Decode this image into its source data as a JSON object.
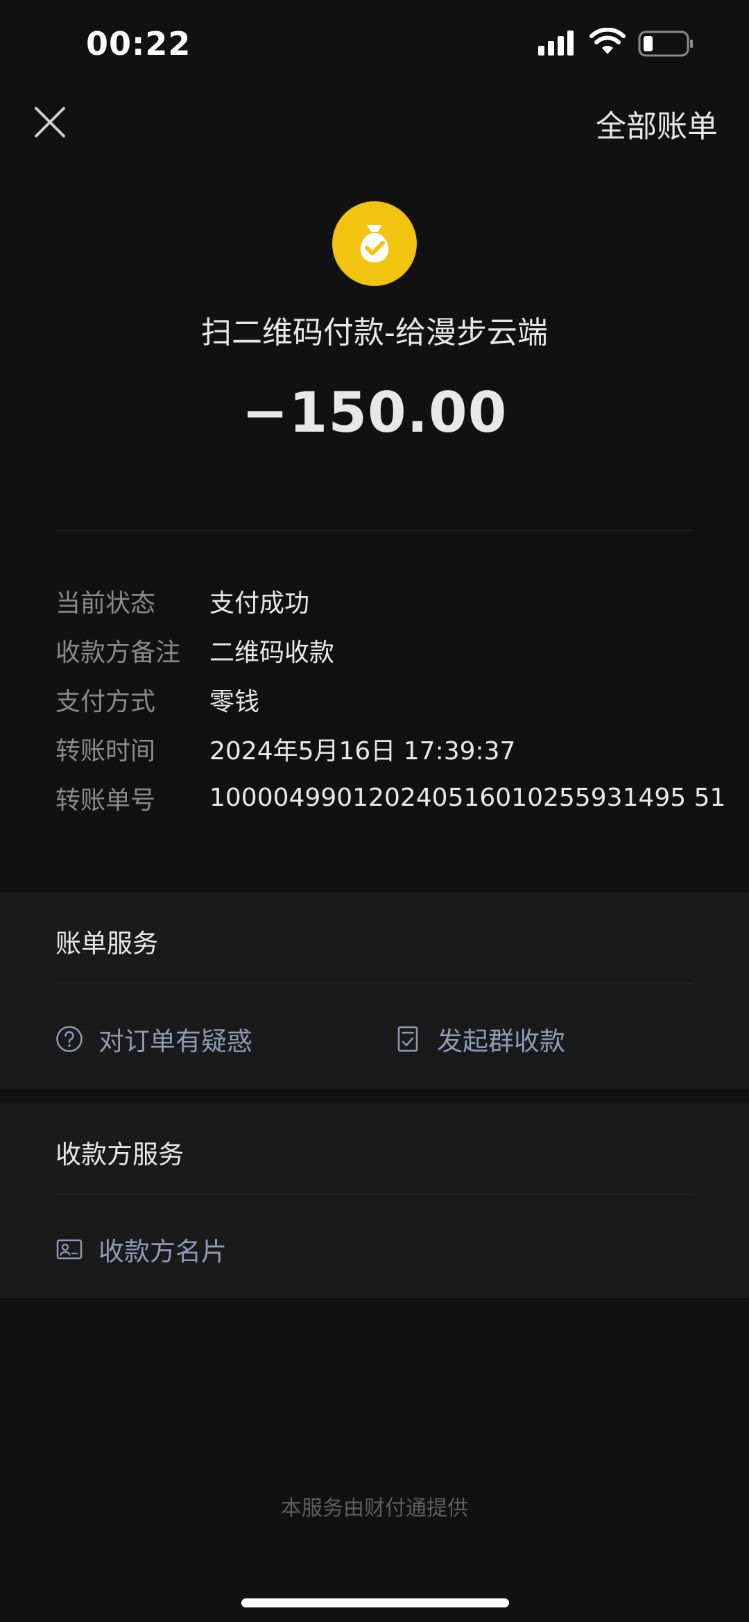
{
  "status_bar": {
    "time": "00:22",
    "icons": [
      "cellular-signal-icon",
      "wifi-icon",
      "battery-icon"
    ]
  },
  "nav": {
    "close_icon": "close-icon",
    "all_bills_label": "全部账单"
  },
  "header": {
    "icon": "money-bag-check-icon",
    "icon_color": "#f1c40f",
    "title": "扫二维码付款-给漫步云端",
    "amount": "−150.00"
  },
  "details": [
    {
      "label": "当前状态",
      "value": "支付成功"
    },
    {
      "label": "收款方备注",
      "value": "二维码收款"
    },
    {
      "label": "支付方式",
      "value": "零钱"
    },
    {
      "label": "转账时间",
      "value": "2024年5月16日 17:39:37"
    },
    {
      "label": "转账单号",
      "value": "100004990120240516010255931495 51"
    }
  ],
  "bill_service": {
    "title": "账单服务",
    "question_label": "对订单有疑惑",
    "group_collect_label": "发起群收款"
  },
  "payee_service": {
    "title": "收款方服务",
    "card_label": "收款方名片"
  },
  "footer": {
    "text": "本服务由财付通提供"
  },
  "colors": {
    "background": "#111111",
    "card": "#1a1a1a",
    "link": "#8c9bb7",
    "muted": "#8a8a8a"
  }
}
